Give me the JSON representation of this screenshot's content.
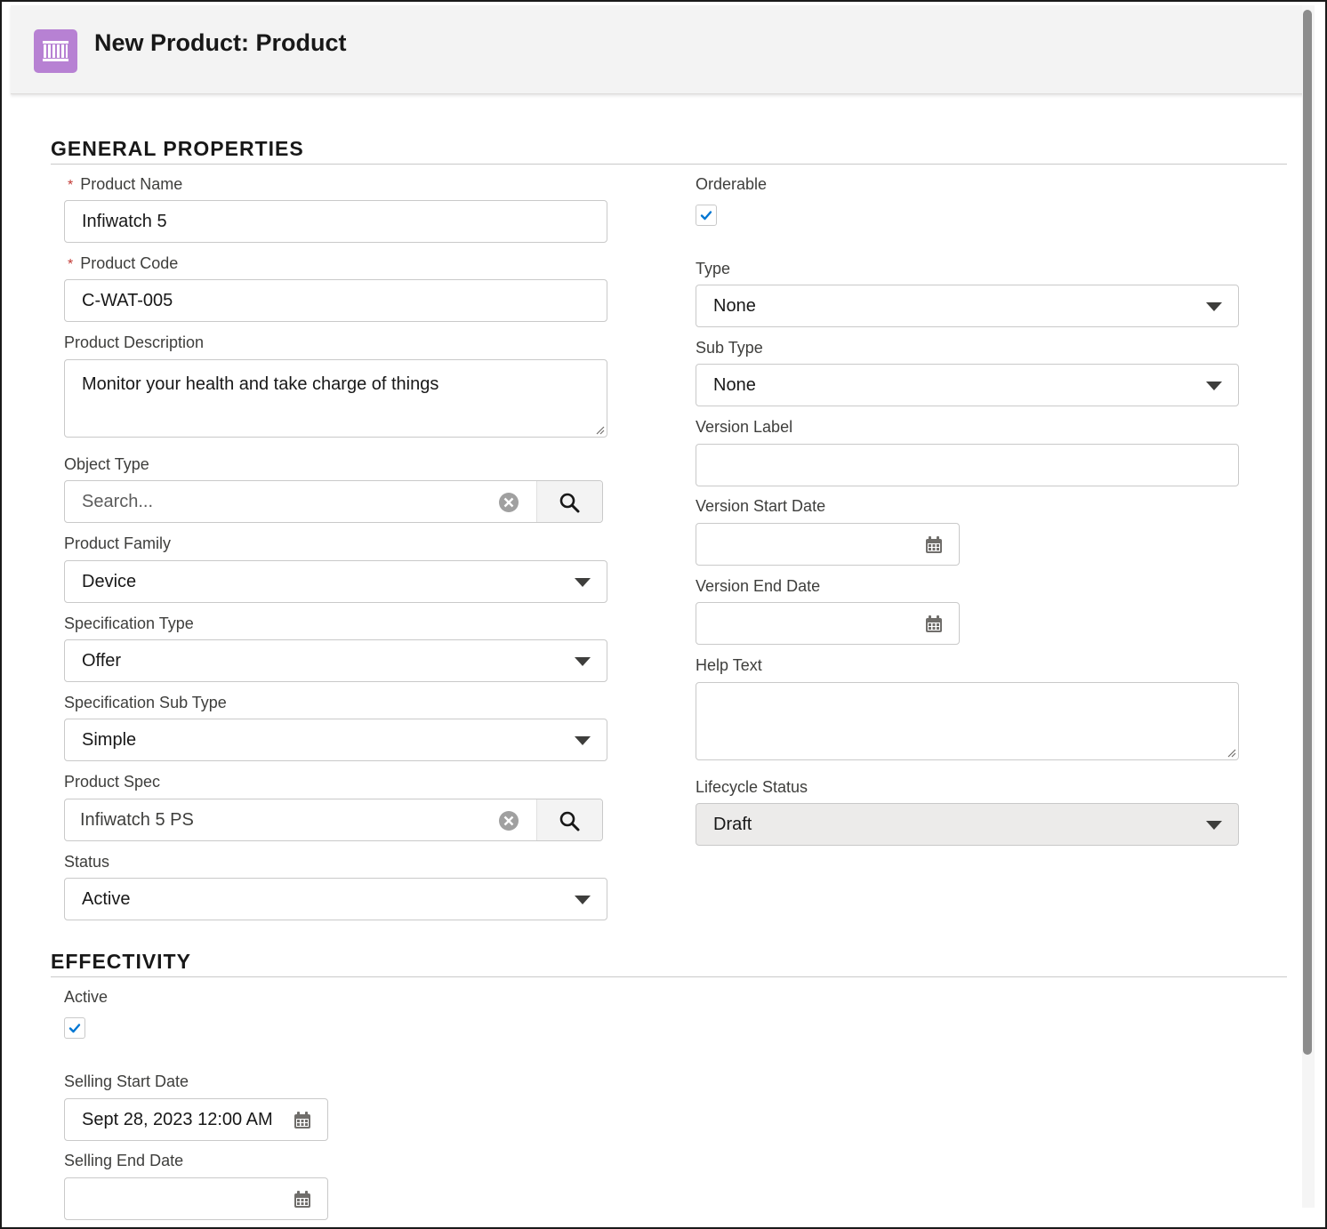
{
  "header": {
    "title": "New Product: Product",
    "icon": "product-icon",
    "accent": "#b781d3"
  },
  "general": {
    "title": "GENERAL PROPERTIES",
    "product_name": {
      "label": "Product Name",
      "value": "Infiwatch 5",
      "required": "*"
    },
    "product_code": {
      "label": "Product Code",
      "value": "C-WAT-005",
      "required": "*"
    },
    "product_description": {
      "label": "Product Description",
      "value": "Monitor your health and take charge of things"
    },
    "object_type": {
      "label": "Object Type",
      "placeholder": "Search..."
    },
    "product_family": {
      "label": "Product Family",
      "value": "Device"
    },
    "specification_type": {
      "label": "Specification Type",
      "value": "Offer"
    },
    "specification_sub_type": {
      "label": "Specification Sub Type",
      "value": "Simple"
    },
    "product_spec": {
      "label": "Product Spec",
      "value": "Infiwatch 5 PS"
    },
    "status": {
      "label": "Status",
      "value": "Active"
    },
    "orderable": {
      "label": "Orderable",
      "checked": true
    },
    "type": {
      "label": "Type",
      "value": "None"
    },
    "sub_type": {
      "label": "Sub Type",
      "value": "None"
    },
    "version_label": {
      "label": "Version Label",
      "value": ""
    },
    "version_start_date": {
      "label": "Version Start Date",
      "value": ""
    },
    "version_end_date": {
      "label": "Version End Date",
      "value": ""
    },
    "help_text": {
      "label": "Help Text",
      "value": ""
    },
    "lifecycle_status": {
      "label": "Lifecycle Status",
      "value": "Draft"
    }
  },
  "effectivity": {
    "title": "EFFECTIVITY",
    "active": {
      "label": "Active",
      "checked": true
    },
    "selling_start_date": {
      "label": "Selling Start Date",
      "value": "Sept 28, 2023 12:00 AM"
    },
    "selling_end_date": {
      "label": "Selling End Date",
      "value": ""
    }
  },
  "colors": {
    "required": "#c23934",
    "check": "#0176d3",
    "disabled_bg": "#ecebea"
  }
}
